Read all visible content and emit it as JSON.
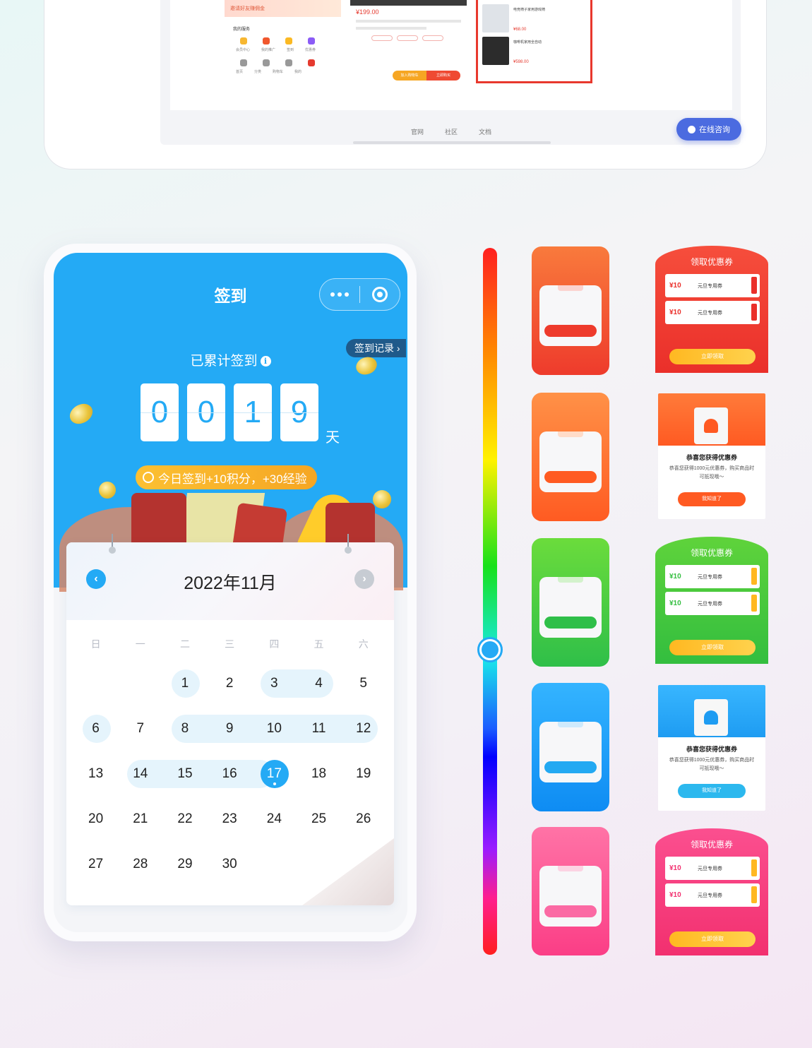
{
  "preview": {
    "banner_text": "邀请好友赚佣金",
    "my_services": "我的服务",
    "service_labels": [
      "会员中心",
      "我的推广",
      "签到",
      "优惠券"
    ],
    "tab_labels": [
      "首页",
      "分类",
      "购物车",
      "我的"
    ],
    "product_price": "¥199.00",
    "bottom_buttons": [
      "加入购物车",
      "立即购买"
    ],
    "list_products": [
      {
        "name": "电竞椅子家用游戏椅",
        "price": "¥68.00"
      },
      {
        "name": "咖啡机家用全自动",
        "price": "¥598.00"
      }
    ],
    "footer_links": [
      "官网",
      "社区",
      "文档"
    ],
    "consult_label": "在线咨询"
  },
  "signin": {
    "title": "签到",
    "record_link": "签到记录 ›",
    "cumulative_label": "已累计签到",
    "info_icon": "i",
    "digits": [
      "0",
      "0",
      "1",
      "9"
    ],
    "day_unit": "天",
    "bonus_text": "今日签到+10积分，+30经验"
  },
  "calendar": {
    "month_title": "2022年11月",
    "weekdays": [
      "日",
      "一",
      "二",
      "三",
      "四",
      "五",
      "六"
    ],
    "weeks": [
      [
        "",
        "",
        "1",
        "2",
        "3",
        "4",
        "5"
      ],
      [
        "6",
        "7",
        "8",
        "9",
        "10",
        "11",
        "12"
      ],
      [
        "13",
        "14",
        "15",
        "16",
        "17",
        "18",
        "19"
      ],
      [
        "20",
        "21",
        "22",
        "23",
        "24",
        "25",
        "26"
      ],
      [
        "27",
        "28",
        "29",
        "30",
        "",
        "",
        ""
      ]
    ],
    "signed_days": [
      1,
      3,
      4,
      6,
      8,
      9,
      10,
      11,
      12,
      14,
      15,
      16
    ],
    "today": 17
  },
  "themes": [
    {
      "name": "red",
      "from": "#f97a3c",
      "to": "#ee3b2c",
      "accent": "#ee3b2c"
    },
    {
      "name": "orange",
      "from": "#ff9147",
      "to": "#ff5b22",
      "accent": "#ff5b22"
    },
    {
      "name": "green",
      "from": "#6bdc3c",
      "to": "#2fbf49",
      "accent": "#2fbf49"
    },
    {
      "name": "blue",
      "from": "#34b4ff",
      "to": "#0e8cf3",
      "accent": "#23a9f2"
    },
    {
      "name": "pink",
      "from": "#ff73a6",
      "to": "#fb3e86",
      "accent": "#fb3e86"
    }
  ],
  "coupons": {
    "title": "领取优惠券",
    "amount": "¥10",
    "name": "元旦专用券",
    "claim": "立即领取",
    "success_title": "恭喜您获得优惠券",
    "success_desc": "恭喜您获得1000元优惠券，购买商品时可抵现哦～",
    "got_it": "我知道了"
  },
  "colors": {
    "primary": "#24aaf5",
    "gold": "#f5a623"
  }
}
